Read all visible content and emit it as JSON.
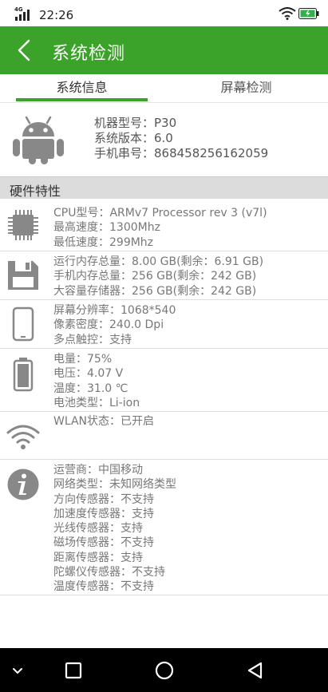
{
  "status_bar": {
    "time": "22:26",
    "network": "4G",
    "icons": [
      "signal-icon",
      "wifi-icon",
      "battery-charging-icon"
    ]
  },
  "header": {
    "title": "系统检测",
    "back_icon": "chevron-left-icon",
    "color": "#3ca32a"
  },
  "tabs": [
    {
      "label": "系统信息",
      "active": true
    },
    {
      "label": "屏幕检测",
      "active": false
    }
  ],
  "device": {
    "icon": "android-icon",
    "model": "机器型号：P30",
    "version": "系统版本：6.0",
    "serial": "手机串号：868458256162059"
  },
  "section": {
    "title": "硬件特性"
  },
  "rows": [
    {
      "icon": "cpu-icon",
      "lines": [
        "CPU型号：ARMv7 Processor rev 3 (v7l)",
        "最高速度：1300Mhz",
        "最低速度：299Mhz"
      ]
    },
    {
      "icon": "storage-icon",
      "lines": [
        "运行内存总量：8.00 GB(剩余：6.91 GB)",
        "手机内存总量：256 GB(剩余：242 GB)",
        "大容量存储器：256 GB(剩余：242 GB)"
      ]
    },
    {
      "icon": "phone-screen-icon",
      "lines": [
        "屏幕分辨率：1068*540",
        "像素密度：240.0 Dpi",
        "多点触控：支持"
      ]
    },
    {
      "icon": "battery-icon",
      "lines": [
        "电量：75%",
        "电压：4.07 V",
        "温度：31.0 ℃",
        "电池类型：Li-ion"
      ]
    },
    {
      "icon": "wifi-icon",
      "lines": [
        "WLAN状态：已开启"
      ]
    },
    {
      "icon": "info-icon",
      "lines": [
        "运营商：中国移动",
        "网络类型：未知网络类型",
        "方向传感器：不支持",
        "加速度传感器：支持",
        "光线传感器：支持",
        "磁场传感器：不支持",
        "距离传感器：支持",
        "陀螺仪传感器：不支持",
        "温度传感器：不支持"
      ]
    }
  ],
  "navbar": {
    "icons": [
      "collapse-icon",
      "recents-icon",
      "home-icon",
      "back-icon"
    ]
  }
}
